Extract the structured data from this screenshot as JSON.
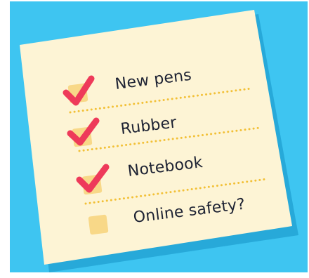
{
  "checklist": {
    "items": [
      {
        "label": "New pens",
        "checked": true
      },
      {
        "label": "Rubber",
        "checked": true
      },
      {
        "label": "Notebook",
        "checked": true
      },
      {
        "label": "Online safety?",
        "checked": false
      }
    ]
  },
  "colors": {
    "background": "#3ec5f1",
    "note_paper": "#fdf4d5",
    "note_shadow": "#27a9d9",
    "checkbox": "#f8d888",
    "checkmark": "#ee3a5a",
    "dotted_line": "#f2c037",
    "text": "#1d2233"
  }
}
